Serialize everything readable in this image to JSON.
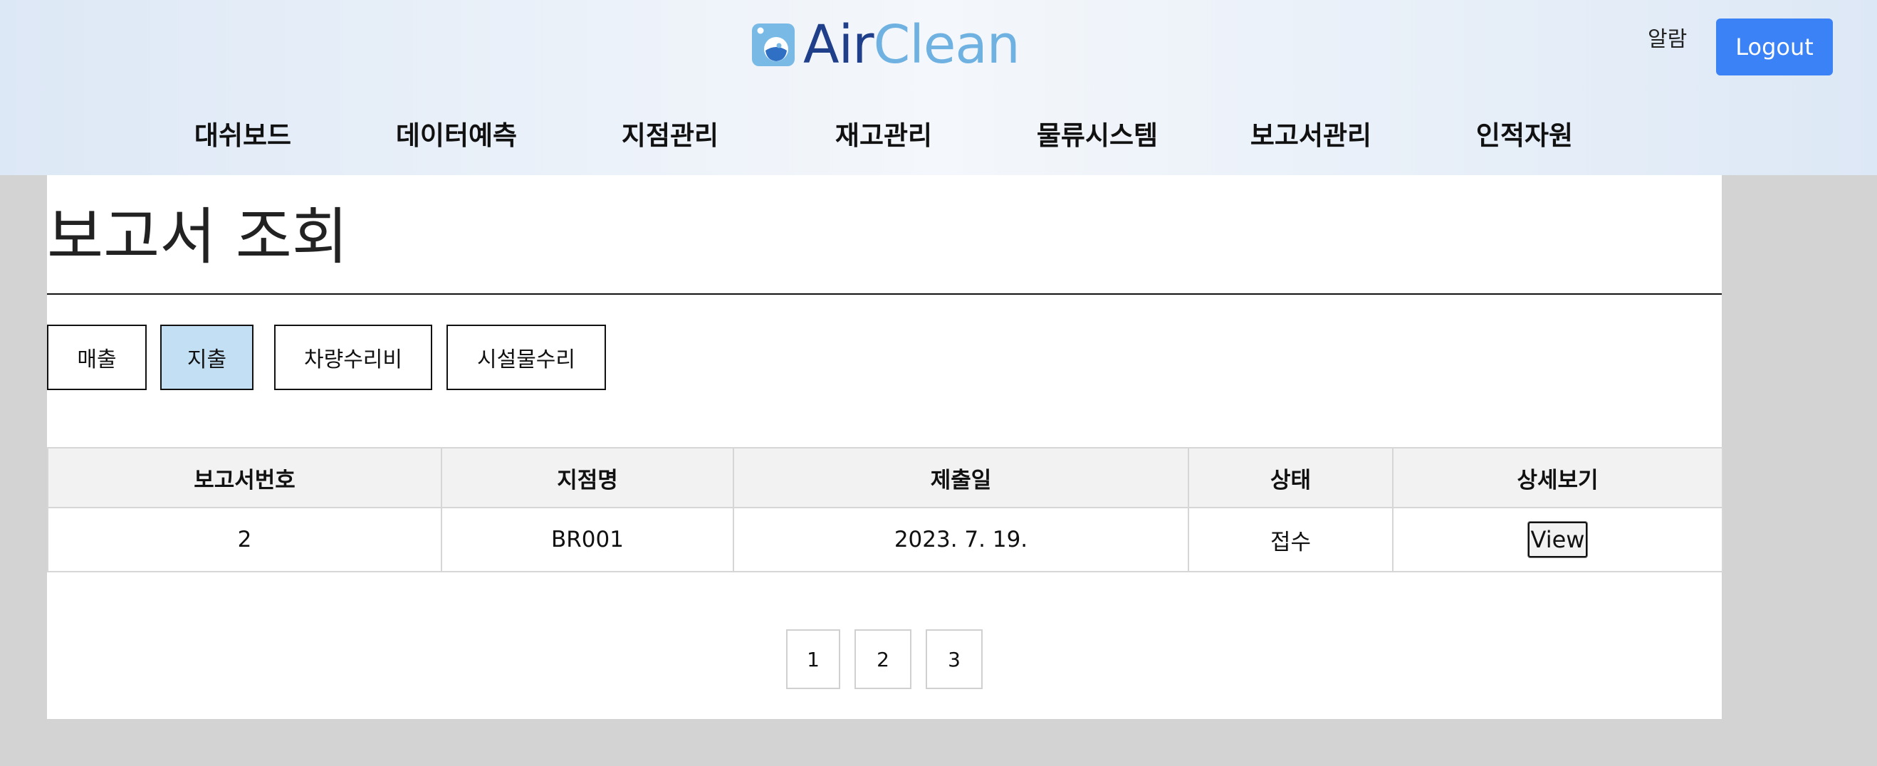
{
  "header": {
    "logo_air": "Air",
    "logo_clean": "Clean",
    "alarm_label": "알람",
    "logout_label": "Logout",
    "nav": [
      {
        "label": "대쉬보드"
      },
      {
        "label": "데이터예측"
      },
      {
        "label": "지점관리"
      },
      {
        "label": "재고관리"
      },
      {
        "label": "물류시스템"
      },
      {
        "label": "보고서관리"
      },
      {
        "label": "인적자원"
      }
    ]
  },
  "main": {
    "title": "보고서 조회",
    "filters": [
      {
        "label": "매출",
        "active": false
      },
      {
        "label": "지출",
        "active": true
      },
      {
        "label": "차량수리비",
        "active": false
      },
      {
        "label": "시설물수리",
        "active": false
      }
    ],
    "table": {
      "columns": [
        "보고서번호",
        "지점명",
        "제출일",
        "상태",
        "상세보기"
      ],
      "rows": [
        {
          "report_no": "2",
          "branch": "BR001",
          "date": "2023. 7. 19.",
          "status": "접수",
          "action": "View"
        }
      ]
    },
    "pagination": [
      "1",
      "2",
      "3"
    ]
  },
  "colors": {
    "page_bg": "#d3d3d3",
    "logout_button": "#3b82f6",
    "active_filter": "#c2dff3",
    "logo_dark": "#1f3f8a",
    "logo_light": "#6fb2e2"
  }
}
